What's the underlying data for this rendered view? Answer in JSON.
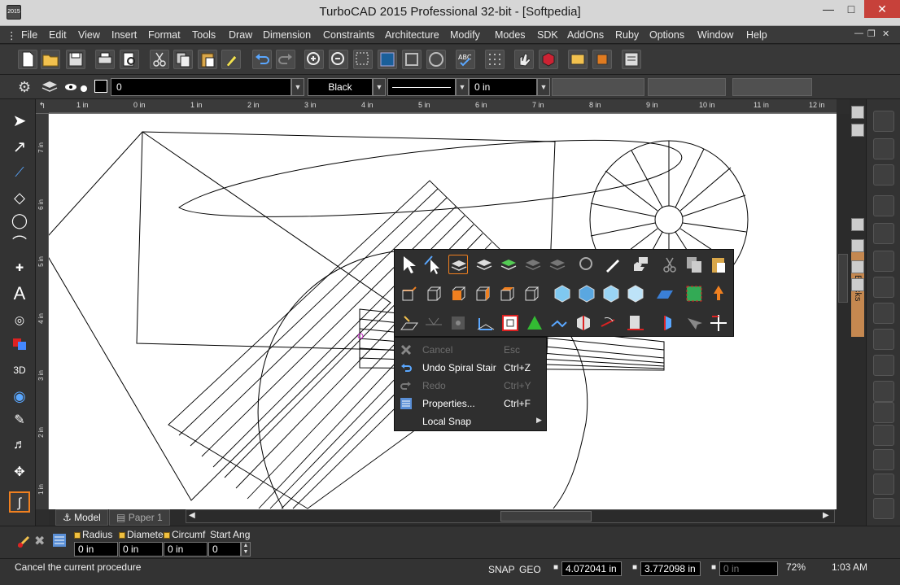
{
  "window": {
    "title": "TurboCAD 2015 Professional 32-bit - [Softpedia]",
    "app_icon": "2015"
  },
  "menus": [
    "File",
    "Edit",
    "View",
    "Insert",
    "Format",
    "Tools",
    "Draw",
    "Dimension",
    "Constraints",
    "Architecture",
    "Modify",
    "Modes",
    "SDK",
    "AddOns",
    "Ruby",
    "Options",
    "Window",
    "Help"
  ],
  "property_bar": {
    "layer": "0",
    "color": "Black",
    "width": "0 in"
  },
  "ruler": {
    "top_labels": [
      "1 in",
      "0 in",
      "1 in",
      "2 in",
      "3 in",
      "4 in",
      "5 in",
      "6 in",
      "7 in",
      "8 in",
      "9 in",
      "10 in",
      "11 in",
      "12 in"
    ],
    "left_labels": [
      "7 in",
      "6 in",
      "5 in",
      "4 in",
      "3 in",
      "2 in",
      "1 in"
    ]
  },
  "blocks_tab": "Blocks",
  "layout_tabs": [
    "Model",
    "Paper 1"
  ],
  "context_menu": [
    {
      "label": "Cancel",
      "shortcut": "Esc",
      "enabled": false,
      "icon": "cancel-icon"
    },
    {
      "label": "Undo Spiral Stair",
      "shortcut": "Ctrl+Z",
      "enabled": true,
      "icon": "undo-icon"
    },
    {
      "label": "Redo",
      "shortcut": "Ctrl+Y",
      "enabled": false,
      "icon": "redo-icon"
    },
    {
      "label": "Properties...",
      "shortcut": "Ctrl+F",
      "enabled": true,
      "icon": "properties-icon"
    },
    {
      "label": "Local Snap",
      "shortcut": "",
      "enabled": true,
      "icon": "",
      "submenu": true
    }
  ],
  "inspector": {
    "fields": [
      {
        "label": "Radius",
        "value": "0 in"
      },
      {
        "label": "Diamete",
        "value": "0 in"
      },
      {
        "label": "Circumf",
        "value": "0 in"
      },
      {
        "label": "Start Ang",
        "value": "0"
      }
    ]
  },
  "status": {
    "message": "Cancel the current procedure",
    "snap": "SNAP",
    "geo": "GEO",
    "x": "4.072041 in",
    "y": "3.772098 in",
    "z": "0 in",
    "zoom": "72%",
    "time": "1:03 AM"
  },
  "colors": {
    "accent": "#f08020",
    "canvas": "#ffffff",
    "chrome": "#333333"
  }
}
